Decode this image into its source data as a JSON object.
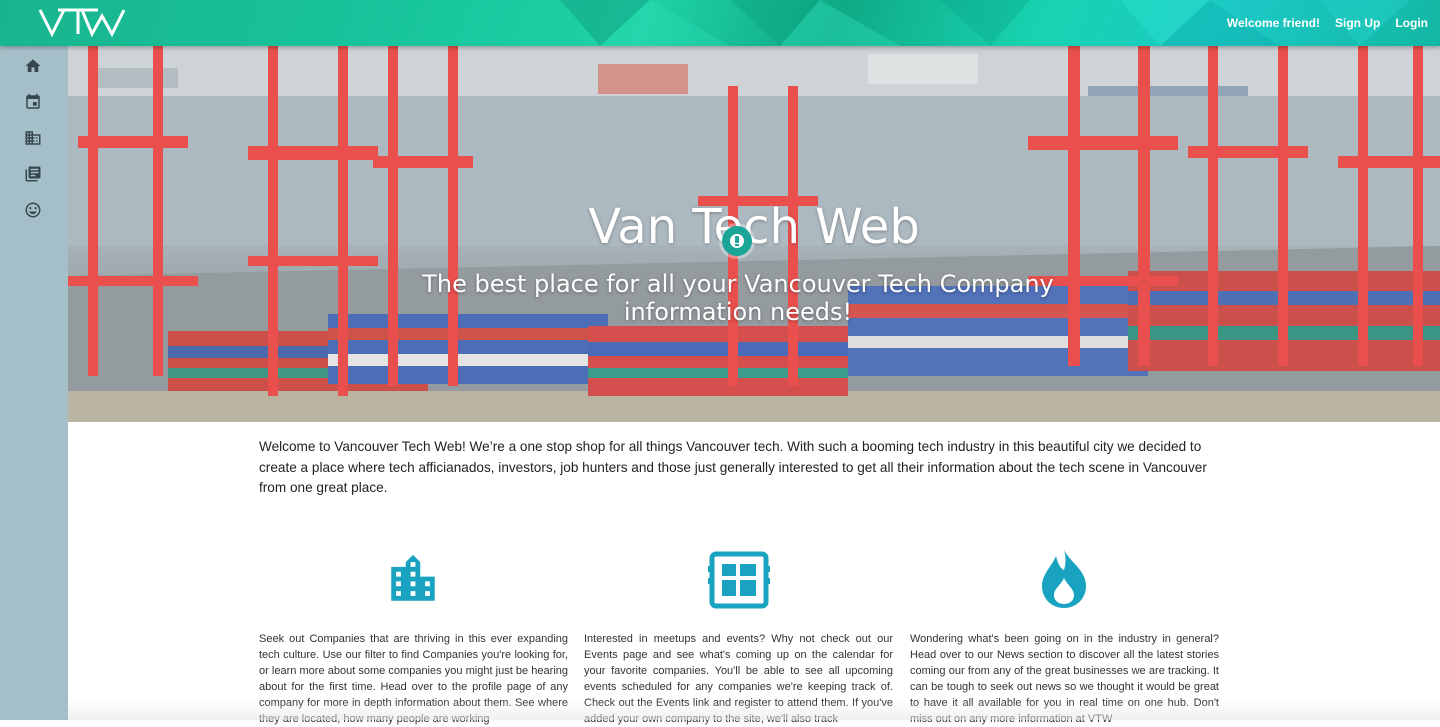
{
  "header": {
    "logo_text": "VTW",
    "welcome_text": "Welcome friend!",
    "signup_label": "Sign Up",
    "login_label": "Login"
  },
  "sidebar": {
    "items": [
      {
        "icon": "home-icon"
      },
      {
        "icon": "calendar-icon"
      },
      {
        "icon": "business-icon"
      },
      {
        "icon": "news-icon"
      },
      {
        "icon": "smiley-icon"
      }
    ]
  },
  "hero": {
    "title": "Van Tech Web",
    "subtitle": "The best place for all your Vancouver Tech Company information needs!"
  },
  "intro": {
    "text": "Welcome to Vancouver Tech Web! We’re a one stop shop for all things Vancouver tech. With such a booming tech industry in this beautiful city we decided to create a place where tech afficianados, investors, job hunters and those just generally interested to get all their information about the tech scene in Vancouver from one great place."
  },
  "features": [
    {
      "icon": "building-icon",
      "text": "Seek out Companies that are thriving in this ever expanding tech culture. Use our filter to find Companies you're looking for, or learn more about some companies you might just be hearing about for the first time. Head over to the profile page of any company for more in depth information about them. See where they are located, how many people are working"
    },
    {
      "icon": "calendar-board-icon",
      "text": "Interested in meetups and events? Why not check out our Events page and see what's coming up on the calendar for your favorite companies. You'll be able to see all upcoming events scheduled for any companies we're keeping track of. Check out the Events link and register to attend them. If you've added your own company to the site, we'll also track"
    },
    {
      "icon": "flame-icon",
      "text": "Wondering what's been going on in the industry in general? Head over to our News section to discover all the latest stories coming our from any of the great businesses we are tracking. It can be tough to seek out news so we thought it would be great to have it all available for you in real time on one hub. Don't miss out on any more information at VTW"
    }
  ],
  "colors": {
    "accent": "#1aa3c0",
    "header": "#17c39a",
    "sidebar": "#a5bfc8"
  }
}
